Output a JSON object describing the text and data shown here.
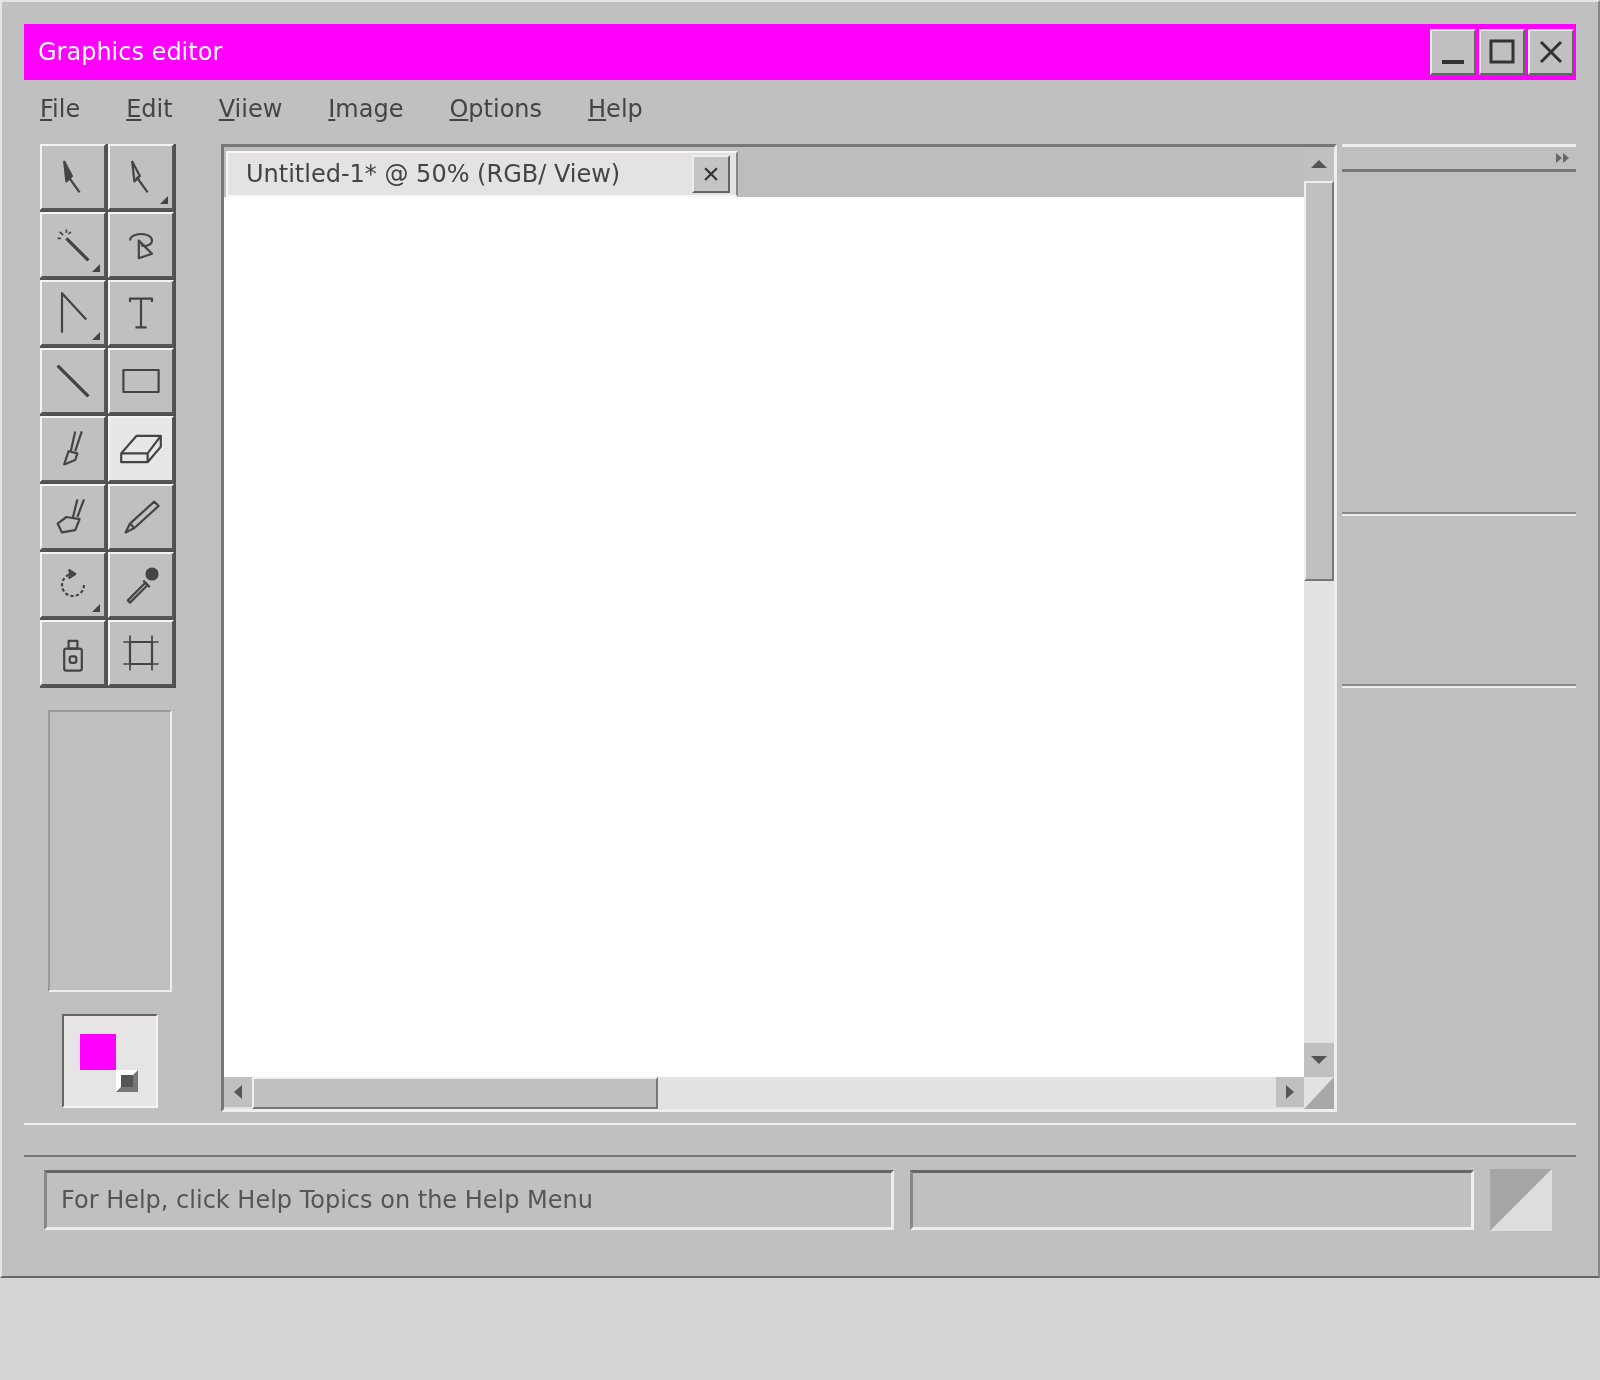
{
  "window": {
    "title": "Graphics editor",
    "controls": [
      {
        "kind": "minimize"
      },
      {
        "kind": "maximize"
      },
      {
        "kind": "close"
      }
    ]
  },
  "menu": [
    "File",
    "Edit",
    "Viiew",
    "Image",
    "Options",
    "Help"
  ],
  "tools": [
    {
      "kind": "arrow",
      "selected": false,
      "flyout": false
    },
    {
      "kind": "direct-select",
      "selected": false,
      "flyout": true
    },
    {
      "kind": "magic-wand",
      "selected": false,
      "flyout": true
    },
    {
      "kind": "lasso",
      "selected": false,
      "flyout": false
    },
    {
      "kind": "pen",
      "selected": false,
      "flyout": true
    },
    {
      "kind": "text",
      "selected": false,
      "flyout": false
    },
    {
      "kind": "line",
      "selected": false,
      "flyout": false
    },
    {
      "kind": "rectangle",
      "selected": false,
      "flyout": false
    },
    {
      "kind": "brush",
      "selected": false,
      "flyout": false
    },
    {
      "kind": "eraser",
      "selected": true,
      "flyout": false
    },
    {
      "kind": "blob-brush",
      "selected": false,
      "flyout": false
    },
    {
      "kind": "pencil",
      "selected": false,
      "flyout": false
    },
    {
      "kind": "rotate",
      "selected": false,
      "flyout": true
    },
    {
      "kind": "eyedropper",
      "selected": false,
      "flyout": false
    },
    {
      "kind": "spray",
      "selected": false,
      "flyout": false
    },
    {
      "kind": "crop",
      "selected": false,
      "flyout": false
    }
  ],
  "document_tab": {
    "title": "Untitled-1* @ 50% (RGB/ View)",
    "close": "×"
  },
  "status_bar": {
    "message": "For Help, click Help Topics on the Help Menu"
  }
}
